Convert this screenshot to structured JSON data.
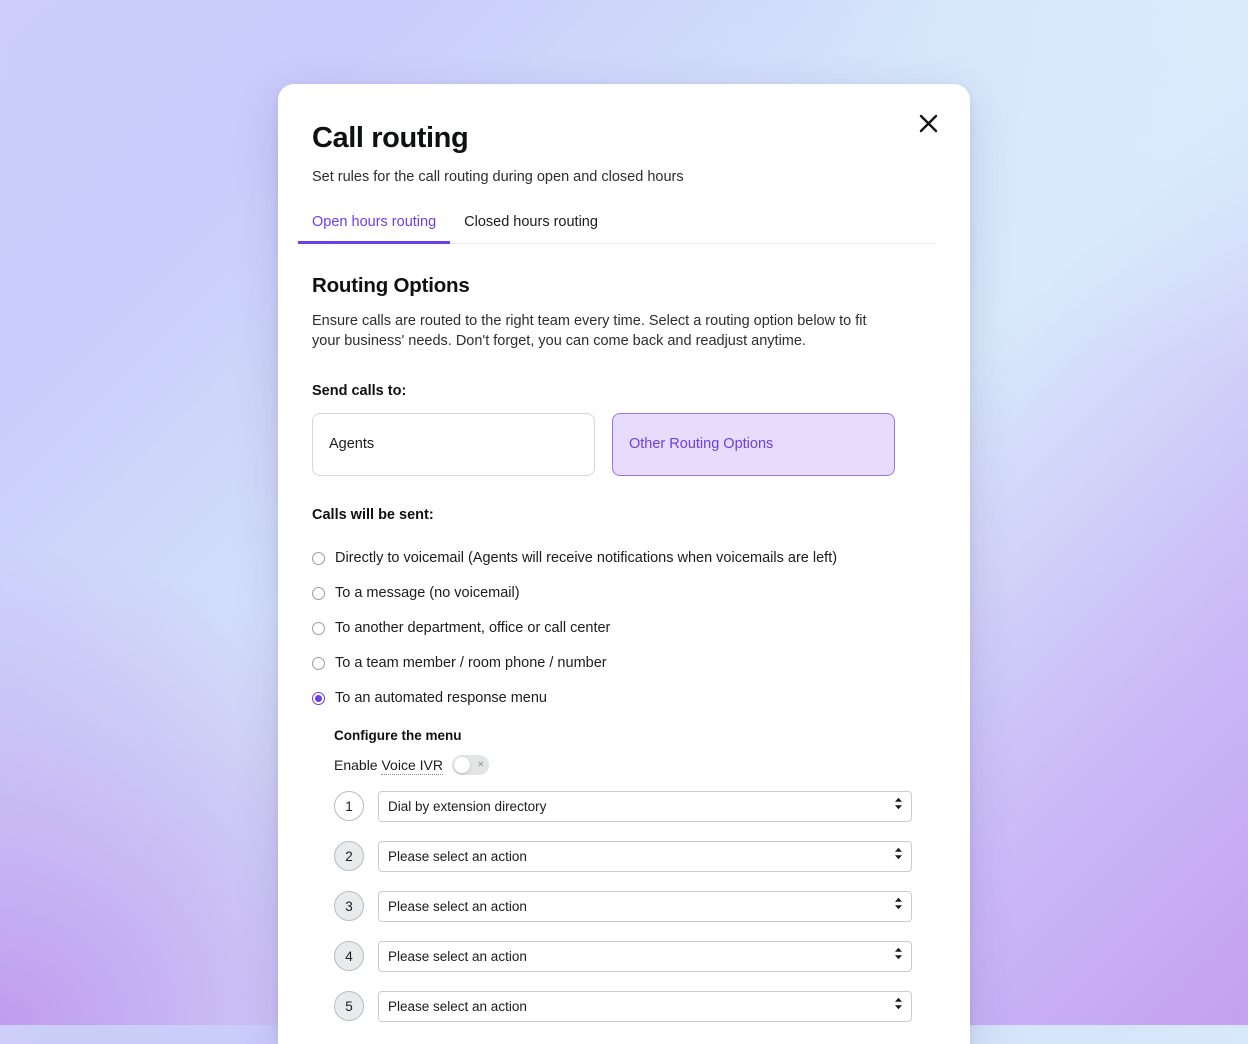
{
  "modal": {
    "title": "Call routing",
    "subtitle": "Set rules for the call routing during open and closed hours",
    "close_icon": "close-icon",
    "tabs": [
      {
        "label": "Open hours routing",
        "active": true
      },
      {
        "label": "Closed hours routing",
        "active": false
      }
    ]
  },
  "routing": {
    "section_title": "Routing Options",
    "section_desc": "Ensure calls are routed to the right team every time. Select a routing option below to fit your business' needs. Don't forget, you can come back and readjust anytime.",
    "send_calls_label": "Send calls to:",
    "cards": [
      {
        "label": "Agents",
        "selected": false
      },
      {
        "label": "Other Routing Options",
        "selected": true
      }
    ],
    "calls_sent_label": "Calls will be sent:",
    "options": [
      {
        "label": "Directly to voicemail (Agents will receive notifications when voicemails are left)",
        "checked": false
      },
      {
        "label": "To a message (no voicemail)",
        "checked": false
      },
      {
        "label": "To another department, office or call center",
        "checked": false
      },
      {
        "label": "To a team member / room phone / number",
        "checked": false
      },
      {
        "label": "To an automated response menu",
        "checked": true
      }
    ]
  },
  "configure": {
    "title": "Configure the menu",
    "ivr_label_prefix": "Enable ",
    "ivr_label_term": "Voice IVR",
    "toggle_state": "off",
    "toggle_off_glyph": "×",
    "menu_rows": [
      {
        "number": "1",
        "value": "Dial by extension directory"
      },
      {
        "number": "2",
        "value": "Please select an action"
      },
      {
        "number": "3",
        "value": "Please select an action"
      },
      {
        "number": "4",
        "value": "Please select an action"
      },
      {
        "number": "5",
        "value": "Please select an action"
      }
    ]
  },
  "colors": {
    "accent": "#6d3fe8",
    "card_selected_bg": "#e7dcfb",
    "card_selected_border": "#9a72ee"
  }
}
